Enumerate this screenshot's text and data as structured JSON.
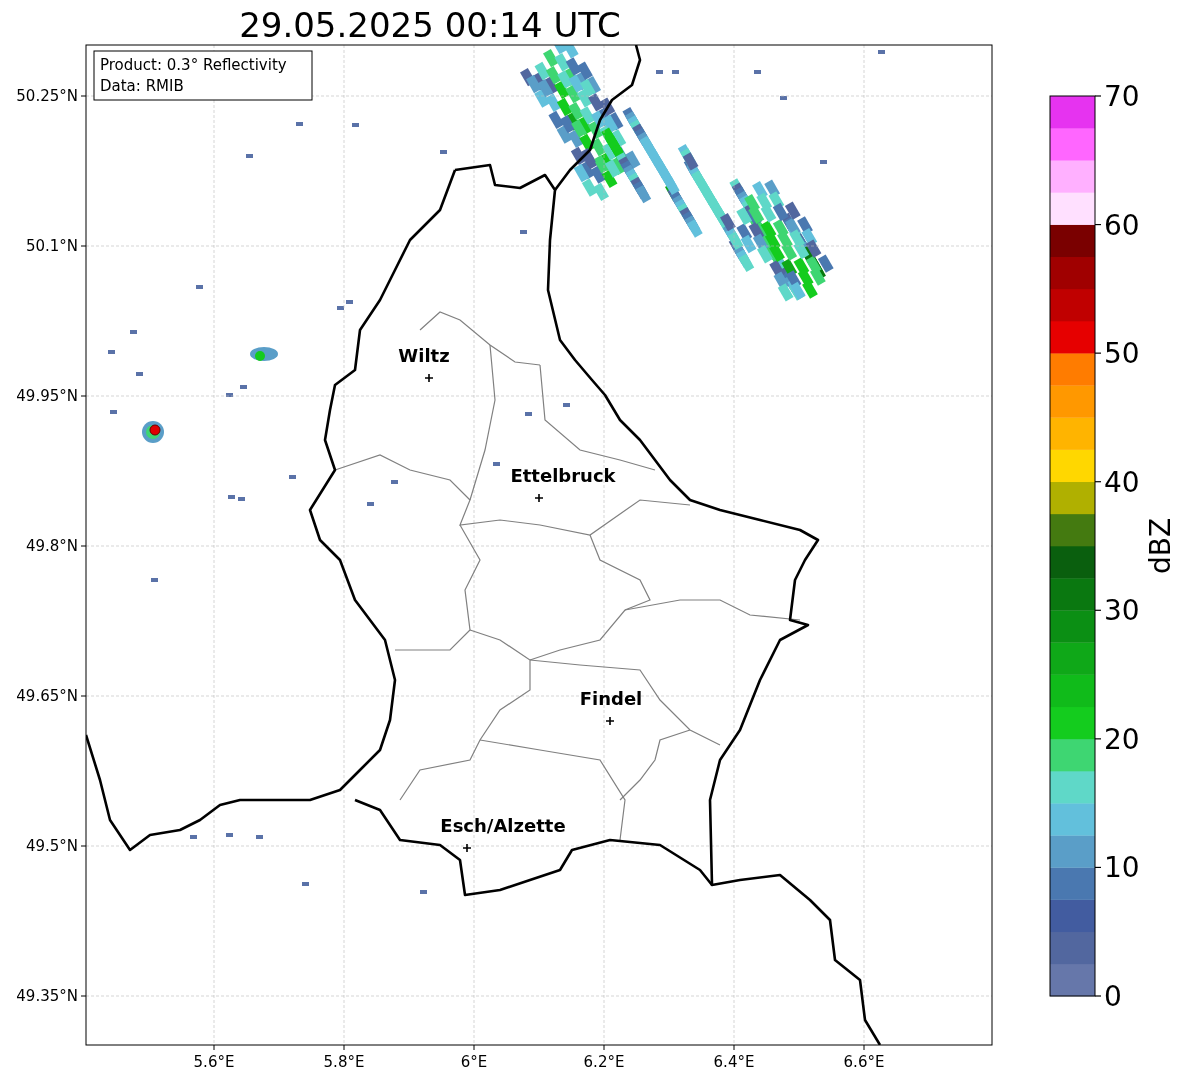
{
  "title": "29.05.2025 00:14 UTC",
  "info_box": {
    "lines": [
      "Product: 0.3° Reflectivity",
      "Data: RMIB"
    ]
  },
  "x_ticks": [
    "5.6°E",
    "5.8°E",
    "6°E",
    "6.2°E",
    "6.4°E",
    "6.6°E"
  ],
  "y_ticks": [
    "50.25°N",
    "50.1°N",
    "49.95°N",
    "49.8°N",
    "49.65°N",
    "49.5°N",
    "49.35°N"
  ],
  "cities": [
    {
      "name": "Wiltz"
    },
    {
      "name": "Ettelbruck"
    },
    {
      "name": "Findel"
    },
    {
      "name": "Esch/Alzette"
    }
  ],
  "colorbar": {
    "label": "dBZ",
    "ticks": [
      "70",
      "60",
      "50",
      "40",
      "30",
      "20",
      "10",
      "0"
    ],
    "bins": [
      {
        "color": "#6677aa"
      },
      {
        "color": "#52679f"
      },
      {
        "color": "#425ca0"
      },
      {
        "color": "#4a78b0"
      },
      {
        "color": "#5a9ec8"
      },
      {
        "color": "#62c0dc"
      },
      {
        "color": "#5fd8c8"
      },
      {
        "color": "#3ed672"
      },
      {
        "color": "#14cc1e"
      },
      {
        "color": "#10bb1a"
      },
      {
        "color": "#0fa818"
      },
      {
        "color": "#0b8f14"
      },
      {
        "color": "#0a7810"
      },
      {
        "color": "#0a5f0e"
      },
      {
        "color": "#447a10"
      },
      {
        "color": "#b0b000"
      },
      {
        "color": "#ffd700"
      },
      {
        "color": "#ffb400"
      },
      {
        "color": "#ff9800"
      },
      {
        "color": "#ff7c00"
      },
      {
        "color": "#e60000"
      },
      {
        "color": "#c00000"
      },
      {
        "color": "#a00000"
      },
      {
        "color": "#7a0000"
      },
      {
        "color": "#ffe0ff"
      },
      {
        "color": "#ffb0ff"
      },
      {
        "color": "#ff66ff"
      },
      {
        "color": "#e633f0"
      }
    ]
  }
}
